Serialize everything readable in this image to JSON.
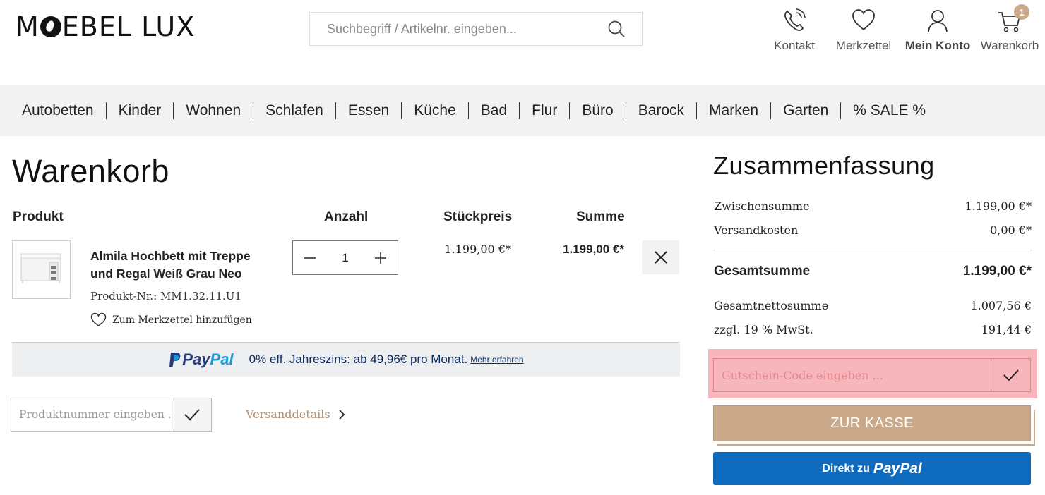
{
  "header": {
    "logo_pre": "M",
    "logo_post": "EBEL LUX",
    "search_placeholder": "Suchbegriff / Artikelnr. eingeben...",
    "icons": {
      "contact": "Kontakt",
      "wishlist": "Merkzettel",
      "account": "Mein Konto",
      "cart": "Warenkorb",
      "cart_count": "1"
    }
  },
  "nav": [
    "Autobetten",
    "Kinder",
    "Wohnen",
    "Schlafen",
    "Essen",
    "Küche",
    "Bad",
    "Flur",
    "Büro",
    "Barock",
    "Marken",
    "Garten",
    "% SALE %"
  ],
  "cart": {
    "title": "Warenkorb",
    "columns": {
      "product": "Produkt",
      "quantity": "Anzahl",
      "unit_price": "Stückpreis",
      "total": "Summe"
    },
    "item": {
      "name": "Almila Hochbett mit Treppe und Regal Weiß Grau Neo",
      "product_no": "Produkt-Nr.: MM1.32.11.U1",
      "wishlist_link": "Zum Merkzettel hinzufügen",
      "quantity": "1",
      "unit_price": "1.199,00 €*",
      "sum": "1.199,00 €*"
    },
    "paypal_banner": {
      "brand_a": "Pay",
      "brand_b": "Pal",
      "text": "0% eff. Jahreszins: ab 49,96€ pro Monat.",
      "more": "Mehr erfahren"
    },
    "article_no_placeholder": "Produktnummer eingeben ...",
    "shipping_details": "Versanddetails"
  },
  "summary": {
    "title": "Zusammenfassung",
    "subtotal_label": "Zwischensumme",
    "subtotal": "1.199,00 €*",
    "shipping_label": "Versandkosten",
    "shipping": "0,00 €*",
    "total_label": "Gesamtsumme",
    "total": "1.199,00 €*",
    "net_label": "Gesamtnettosumme",
    "net": "1.007,56 €",
    "vat_label": "zzgl. 19 % MwSt.",
    "vat": "191,44 €",
    "voucher_placeholder": "Gutschein-Code eingeben ...",
    "checkout": "ZUR KASSE",
    "paypal_direct": "Direkt zu",
    "paypal_word": "PayPal"
  },
  "colors": {
    "accent": "#c9a98a",
    "paypal_blue": "#0f6bbd",
    "highlight": "#f7b6bb"
  }
}
